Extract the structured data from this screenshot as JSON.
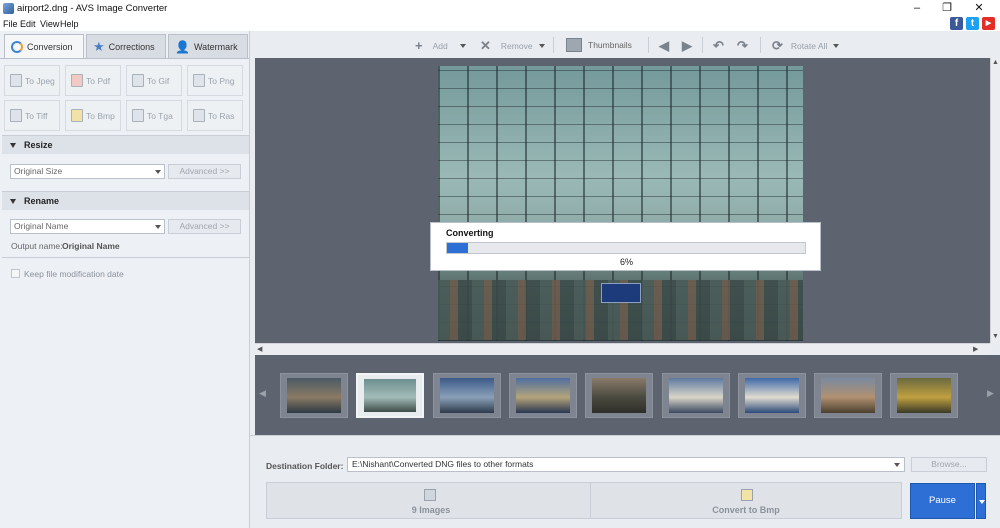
{
  "window": {
    "title": "airport2.dng - AVS Image Converter",
    "controls": {
      "minimize": "–",
      "maximize": "❐",
      "close": "✕"
    }
  },
  "menu": [
    "File",
    "Edit",
    "View",
    "Help"
  ],
  "social": [
    {
      "name": "facebook-icon",
      "glyph": "f",
      "color": "#3b5998"
    },
    {
      "name": "twitter-icon",
      "glyph": "t",
      "color": "#1da1f2"
    },
    {
      "name": "youtube-icon",
      "glyph": "▶",
      "color": "#e52d27"
    }
  ],
  "tabs": [
    {
      "label": "Conversion",
      "icon": "conversion-icon",
      "active": true
    },
    {
      "label": "Corrections",
      "icon": "star-icon",
      "active": false
    },
    {
      "label": "Watermark",
      "icon": "watermark-icon",
      "active": false
    }
  ],
  "formats": [
    "To Jpeg",
    "To Pdf",
    "To Gif",
    "To Png",
    "To Tiff",
    "To Bmp",
    "To Tga",
    "To Ras"
  ],
  "resize": {
    "heading": "Resize",
    "value": "Original Size",
    "advanced": "Advanced >>"
  },
  "rename": {
    "heading": "Rename",
    "value": "Original Name",
    "advanced": "Advanced >>",
    "output_label": "Output name:",
    "output_value": "Original Name"
  },
  "keep_date": "Keep file modification date",
  "toolbar": {
    "add": "Add",
    "remove": "Remove",
    "thumbnails": "Thumbnails",
    "rotate_all": "Rotate All"
  },
  "converting": {
    "title": "Converting",
    "percent_text": "6%",
    "progress": 0.06
  },
  "thumbnails": [
    {
      "colors": [
        "#4b5a66",
        "#8a7a64",
        "#2d3a44"
      ]
    },
    {
      "colors": [
        "#6d8f8f",
        "#a3bcb8",
        "#3e4c48"
      ],
      "selected": true
    },
    {
      "colors": [
        "#3c5a8a",
        "#8aa0b8",
        "#2e3a4a"
      ]
    },
    {
      "colors": [
        "#4e6ea0",
        "#b4a47a",
        "#2a3550"
      ]
    },
    {
      "colors": [
        "#8a7a6a",
        "#4a4a40",
        "#2e2e28"
      ]
    },
    {
      "colors": [
        "#5e7aa0",
        "#d8d4c8",
        "#3a4860"
      ]
    },
    {
      "colors": [
        "#3f68a8",
        "#e0dcd0",
        "#2c4a7a"
      ]
    },
    {
      "colors": [
        "#7a8aa0",
        "#b09070",
        "#4a4030"
      ]
    },
    {
      "colors": [
        "#6a6a40",
        "#c0a040",
        "#3a3a28"
      ]
    }
  ],
  "destination": {
    "label": "Destination Folder:",
    "path": "E:\\Nishant\\Converted DNG files to other formats",
    "browse": "Browse..."
  },
  "steps": {
    "images": "9 Images",
    "convert": "Convert to Bmp"
  },
  "pause": "Pause",
  "colors": {
    "accent": "#2e6fd6",
    "preview_bg": "#5e6370"
  }
}
